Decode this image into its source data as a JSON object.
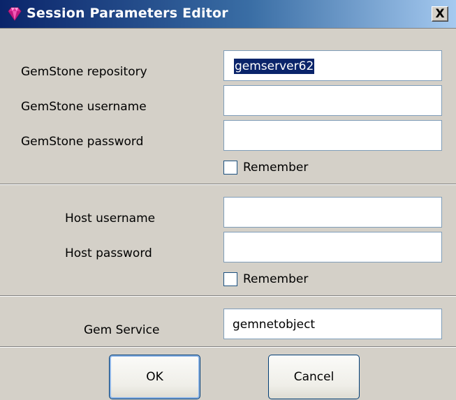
{
  "window": {
    "title": "Session Parameters Editor",
    "close_glyph": "X"
  },
  "gemstone": {
    "repository_label": "GemStone repository",
    "repository_value": "gemserver62",
    "username_label": "GemStone username",
    "username_value": "",
    "password_label": "GemStone password",
    "password_value": "",
    "remember_label": "Remember",
    "remember_checked": false
  },
  "host": {
    "username_label": "Host username",
    "username_value": "",
    "password_label": "Host password",
    "password_value": "",
    "remember_label": "Remember",
    "remember_checked": false
  },
  "service": {
    "label": "Gem Service",
    "value": "gemnetobject"
  },
  "buttons": {
    "ok_label": "OK",
    "cancel_label": "Cancel"
  },
  "icons": {
    "title": "gem-icon",
    "close": "close-icon"
  },
  "colors": {
    "title_start": "#0a246a",
    "title_end": "#a6caf0",
    "selection": "#0a246a",
    "gem_icon": "#e0309a",
    "dialog_bg": "#d4d0c8"
  }
}
